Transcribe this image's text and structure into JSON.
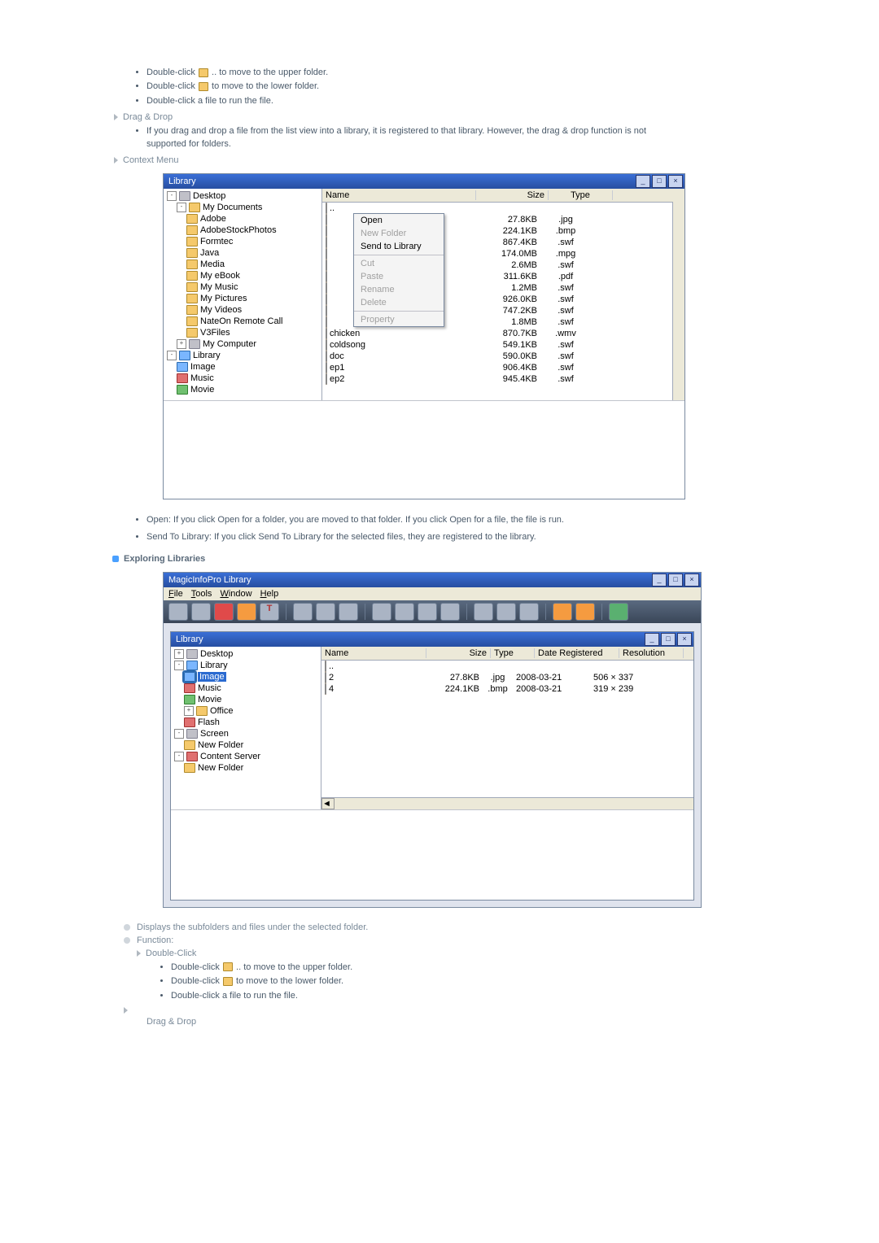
{
  "intro_list": {
    "i1a": "Double-click",
    "i1b": ".. to move to the upper folder.",
    "i2a": "Double-click",
    "i2b": "to move to the lower folder.",
    "i3": "Double-click a file to run the file."
  },
  "drag_drop": {
    "title": "Drag & Drop",
    "body": "If you drag and drop a file from the list view into a library, it is registered to that library. However, the drag & drop function is not supported for folders."
  },
  "context_menu_heading": "Context Menu",
  "library_win": {
    "title": "Library",
    "tree": [
      {
        "t": "Desktop",
        "lvl": 0,
        "box": "-",
        "ico": "gray"
      },
      {
        "t": "My Documents",
        "lvl": 1,
        "box": "-",
        "ico": "fold"
      },
      {
        "t": "Adobe",
        "lvl": 2,
        "ico": "fold"
      },
      {
        "t": "AdobeStockPhotos",
        "lvl": 2,
        "ico": "fold"
      },
      {
        "t": "Formtec",
        "lvl": 2,
        "ico": "fold"
      },
      {
        "t": "Java",
        "lvl": 2,
        "ico": "fold"
      },
      {
        "t": "Media",
        "lvl": 2,
        "ico": "fold"
      },
      {
        "t": "My eBook",
        "lvl": 2,
        "ico": "fold"
      },
      {
        "t": "My Music",
        "lvl": 2,
        "ico": "fold"
      },
      {
        "t": "My Pictures",
        "lvl": 2,
        "ico": "fold"
      },
      {
        "t": "My Videos",
        "lvl": 2,
        "ico": "fold"
      },
      {
        "t": "NateOn Remote Call",
        "lvl": 2,
        "ico": "fold"
      },
      {
        "t": "V3Files",
        "lvl": 2,
        "ico": "fold"
      },
      {
        "t": "My Computer",
        "lvl": 1,
        "box": "+",
        "ico": "gray"
      },
      {
        "t": "Library",
        "lvl": 0,
        "box": "-",
        "ico": "blue"
      },
      {
        "t": "Image",
        "lvl": 1,
        "ico": "blue"
      },
      {
        "t": "Music",
        "lvl": 1,
        "ico": "red"
      },
      {
        "t": "Movie",
        "lvl": 1,
        "ico": "green"
      }
    ],
    "columns": {
      "name": "Name",
      "size": "Size",
      "type": "Type"
    },
    "rows": [
      {
        "n": "..",
        "s": "",
        "t": ""
      },
      {
        "n": "",
        "s": "27.8KB",
        "t": ".jpg"
      },
      {
        "n": "",
        "s": "224.1KB",
        "t": ".bmp"
      },
      {
        "n": "",
        "s": "867.4KB",
        "t": ".swf"
      },
      {
        "n": "",
        "s": "174.0MB",
        "t": ".mpg"
      },
      {
        "n": "",
        "s": "2.6MB",
        "t": ".swf"
      },
      {
        "n": "",
        "s": "311.6KB",
        "t": ".pdf"
      },
      {
        "n": "",
        "s": "1.2MB",
        "t": ".swf"
      },
      {
        "n": "",
        "s": "926.0KB",
        "t": ".swf"
      },
      {
        "n": "",
        "s": "747.2KB",
        "t": ".swf"
      },
      {
        "n": "",
        "s": "1.8MB",
        "t": ".swf"
      },
      {
        "n": "chicken",
        "s": "870.7KB",
        "t": ".wmv"
      },
      {
        "n": "coldsong",
        "s": "549.1KB",
        "t": ".swf"
      },
      {
        "n": "doc",
        "s": "590.0KB",
        "t": ".swf"
      },
      {
        "n": "ep1",
        "s": "906.4KB",
        "t": ".swf"
      },
      {
        "n": "ep2",
        "s": "945.4KB",
        "t": ".swf"
      }
    ],
    "context_menu": {
      "open": "Open",
      "new_folder": "New Folder",
      "send": "Send to Library",
      "cut": "Cut",
      "paste": "Paste",
      "rename": "Rename",
      "delete": "Delete",
      "property": "Property"
    }
  },
  "context_bullets": {
    "b1": "Open: If you click Open for a folder, you are moved to that folder. If you click Open for a file, the file is run.",
    "b2": "Send To Library: If you click Send To Library for the selected files, they are registered to the library."
  },
  "exploring_heading": "Exploring Libraries",
  "magic_win": {
    "title": "MagicInfoPro Library",
    "menubar": {
      "file": "File",
      "tools": "Tools",
      "window": "Window",
      "help": "Help"
    },
    "inner_title": "Library",
    "columns": {
      "name": "Name",
      "size": "Size",
      "type": "Type",
      "date": "Date Registered",
      "res": "Resolution"
    },
    "tree": [
      {
        "t": "Desktop",
        "lvl": 0,
        "box": "+",
        "ico": "gray"
      },
      {
        "t": "Library",
        "lvl": 0,
        "box": "-",
        "ico": "blue"
      },
      {
        "t": "Image",
        "lvl": 1,
        "ico": "blue",
        "sel": true
      },
      {
        "t": "Music",
        "lvl": 1,
        "ico": "red"
      },
      {
        "t": "Movie",
        "lvl": 1,
        "ico": "green"
      },
      {
        "t": "Office",
        "lvl": 1,
        "box": "+",
        "ico": "fold"
      },
      {
        "t": "Flash",
        "lvl": 1,
        "ico": "red"
      },
      {
        "t": "Screen",
        "lvl": 0,
        "box": "-",
        "ico": "gray"
      },
      {
        "t": "New Folder",
        "lvl": 1,
        "ico": "fold"
      },
      {
        "t": "Content Server",
        "lvl": 0,
        "box": "-",
        "ico": "red"
      },
      {
        "t": "New Folder",
        "lvl": 1,
        "ico": "fold"
      }
    ],
    "rows": [
      {
        "n": "..",
        "s": "",
        "t": "",
        "d": "",
        "r": ""
      },
      {
        "n": "2",
        "s": "27.8KB",
        "t": ".jpg",
        "d": "2008-03-21",
        "r": "506 × 337"
      },
      {
        "n": "4",
        "s": "224.1KB",
        "t": ".bmp",
        "d": "2008-03-21",
        "r": "319 × 239"
      }
    ]
  },
  "lower_text": {
    "displays": "Displays the subfolders and files under the selected folder.",
    "function": "Function:",
    "double_click": "Double-Click",
    "l1a": "Double-click",
    "l1b": ".. to move to the upper folder.",
    "l2a": "Double-click",
    "l2b": "to move to the lower folder.",
    "l3": "Double-click a file to run the file.",
    "drag": "Drag & Drop"
  }
}
